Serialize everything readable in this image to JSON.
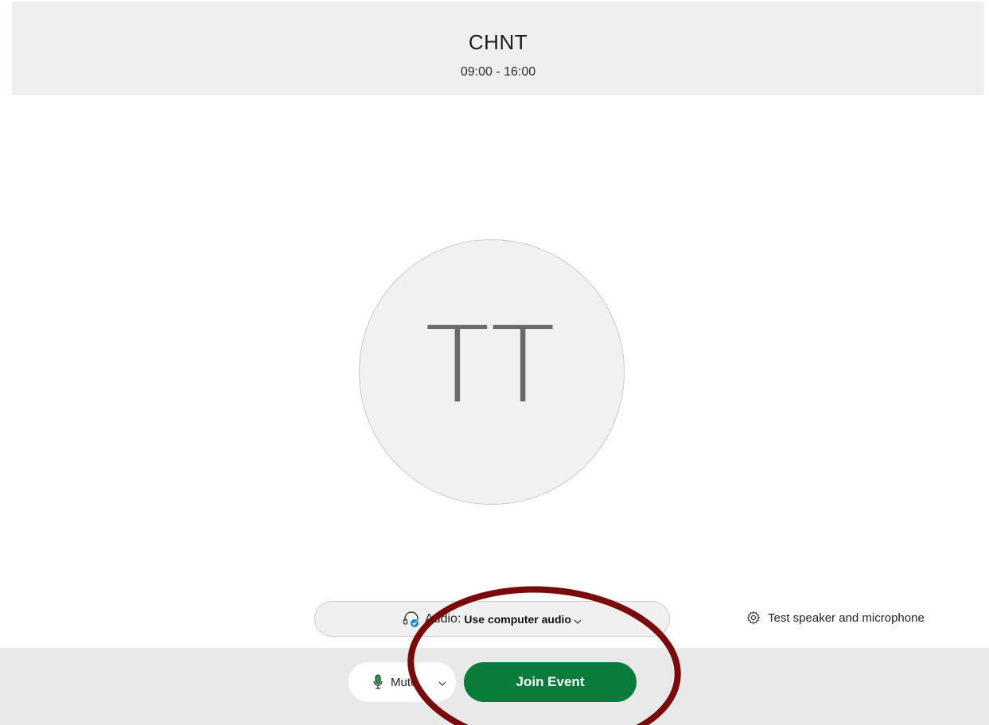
{
  "meeting": {
    "title": "CHNT",
    "time": "09:00 - 16:00"
  },
  "avatar": {
    "initials": "TT"
  },
  "audio": {
    "prefix": "Audio:",
    "value": "Use computer audio",
    "icon": "headset-icon"
  },
  "test_link": {
    "label": "Test speaker and microphone",
    "icon": "gear-icon"
  },
  "controls": {
    "mute_label": "Mute",
    "mute_icon": "microphone-icon",
    "join_label": "Join Event"
  },
  "colors": {
    "join_button": "#097c3b",
    "annotation": "#7a0a0a",
    "mic_accent": "#1f9b4b",
    "audio_check": "#1a85d6"
  }
}
